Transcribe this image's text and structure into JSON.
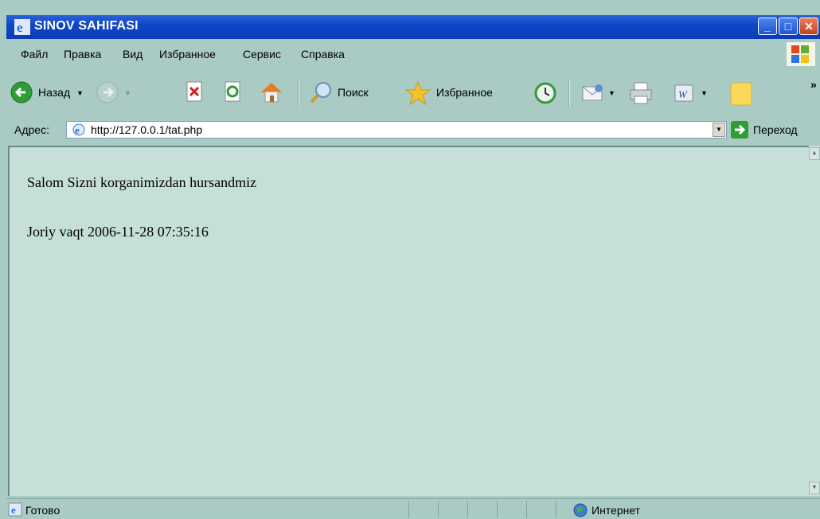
{
  "window": {
    "title": "SINOV SAHIFASI"
  },
  "menu": [
    "Файл",
    "Правка",
    "Вид",
    "Избранное",
    "Сервис",
    "Справка"
  ],
  "toolbar": {
    "back_label": "Назад",
    "search_label": "Поиск",
    "favorites_label": "Избранное"
  },
  "address": {
    "label": "Адрес:",
    "url": "http://127.0.0.1/tat.php",
    "go_label": "Переход"
  },
  "page": {
    "greeting": "Salom Sizni korganimizdan hursandmiz",
    "time_line": "Joriy vaqt 2006-11-28 07:35:16"
  },
  "status": {
    "text": "Готово",
    "zone": "Интернет"
  },
  "colors": {
    "chrome": "#a9cbc3",
    "content_bg": "#c6dfd8",
    "titlebar": "#0f47c8"
  }
}
